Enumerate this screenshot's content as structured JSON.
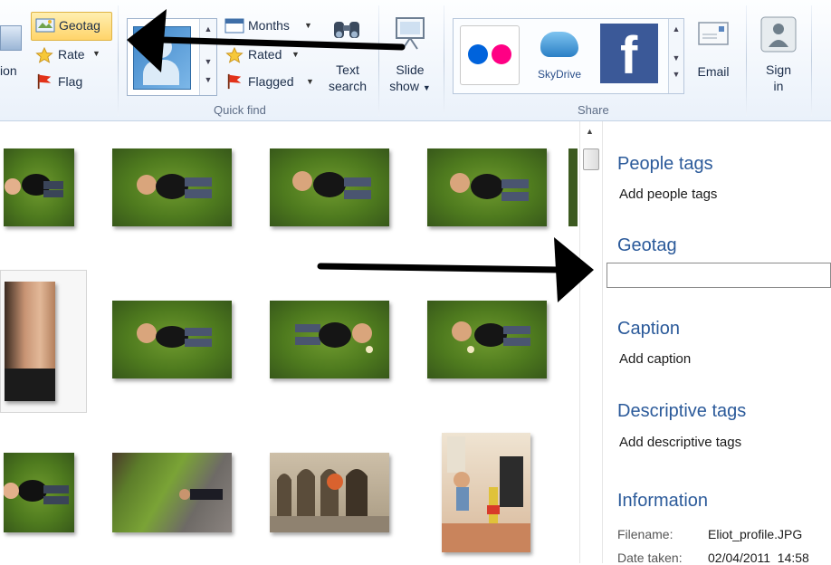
{
  "ribbon": {
    "partial_label": "ion",
    "geotag_label": "Geotag",
    "rate_label": "Rate",
    "flag_label": "Flag",
    "quick_find": {
      "months_label": "Months",
      "rated_label": "Rated",
      "flagged_label": "Flagged",
      "text_search_line1": "Text",
      "text_search_line2": "search",
      "group_label": "Quick find"
    },
    "slideshow_line1": "Slide",
    "slideshow_line2": "show",
    "share": {
      "skydrive_label": "SkyDrive",
      "email_label": "Email",
      "signin_line1": "Sign",
      "signin_line2": "in",
      "group_label": "Share"
    }
  },
  "details_pane": {
    "people_tags_heading": "People tags",
    "people_tags_link": "Add people tags",
    "geotag_heading": "Geotag",
    "geotag_value": "",
    "caption_heading": "Caption",
    "caption_link": "Add caption",
    "descriptive_heading": "Descriptive tags",
    "descriptive_link": "Add descriptive tags",
    "information_heading": "Information",
    "filename_key": "Filename:",
    "filename_value": "Eliot_profile.JPG",
    "date_key": "Date taken:",
    "date_value": "02/04/2011  14:58"
  },
  "colors": {
    "accent_heading": "#2b5a9a",
    "highlight_button": "#ffd46a",
    "facebook": "#3b5998",
    "flickr_blue": "#0063dc",
    "flickr_pink": "#ff0084"
  }
}
